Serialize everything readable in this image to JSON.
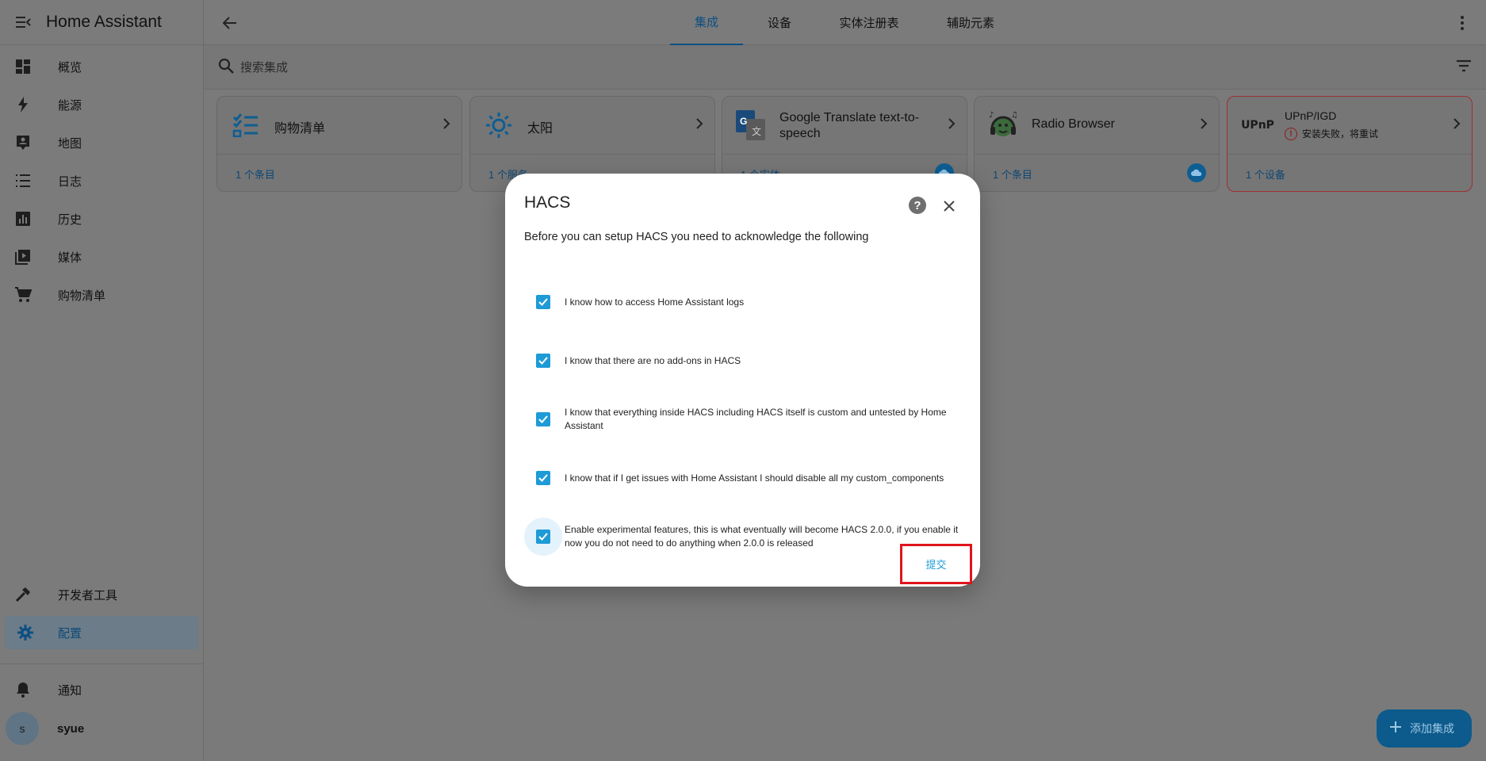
{
  "app": {
    "title": "Home Assistant"
  },
  "sidebar": {
    "items": [
      {
        "label": "概览",
        "icon": "dashboard-icon"
      },
      {
        "label": "能源",
        "icon": "lightning-icon"
      },
      {
        "label": "地图",
        "icon": "map-icon"
      },
      {
        "label": "日志",
        "icon": "list-icon"
      },
      {
        "label": "历史",
        "icon": "chart-icon"
      },
      {
        "label": "媒体",
        "icon": "media-icon"
      },
      {
        "label": "购物清单",
        "icon": "cart-icon"
      }
    ],
    "bottom_items": [
      {
        "label": "开发者工具",
        "icon": "hammer-icon"
      },
      {
        "label": "配置",
        "icon": "gear-icon",
        "active": true
      }
    ],
    "notifications_label": "通知",
    "user": {
      "initial": "s",
      "name": "syue"
    }
  },
  "topbar": {
    "tabs": [
      {
        "label": "集成",
        "active": true
      },
      {
        "label": "设备",
        "active": false
      },
      {
        "label": "实体注册表",
        "active": false
      },
      {
        "label": "辅助元素",
        "active": false
      }
    ]
  },
  "search": {
    "placeholder": "搜索集成"
  },
  "cards": [
    {
      "title": "购物清单",
      "link": "1 个条目"
    },
    {
      "title": "太阳",
      "link": "1 个服务"
    },
    {
      "title": "Google Translate text-to-speech",
      "link": "1 个实体",
      "cloud": true
    },
    {
      "title": "Radio Browser",
      "link": "1 个条目",
      "cloud": true
    },
    {
      "title": "UPnP/IGD",
      "logo_text": "UPnP",
      "subtitle": "安装失败，将重试",
      "link": "1 个设备",
      "error": true
    }
  ],
  "dialog": {
    "title": "HACS",
    "intro": "Before you can setup HACS you need to acknowledge the following",
    "checkboxes": [
      {
        "label": "I know how to access Home Assistant logs",
        "checked": true
      },
      {
        "label": "I know that there are no add-ons in HACS",
        "checked": true
      },
      {
        "label": "I know that everything inside HACS including HACS itself is custom and untested by Home Assistant",
        "checked": true
      },
      {
        "label": "I know that if I get issues with Home Assistant I should disable all my custom_components",
        "checked": true
      },
      {
        "label": "Enable experimental features, this is what eventually will become HACS 2.0.0, if you enable it now you do not need to do anything when 2.0.0 is released",
        "checked": true
      }
    ],
    "submit_label": "提交"
  },
  "fab": {
    "label": "添加集成"
  },
  "colors": {
    "accent": "#1e9bd7",
    "error": "#e0141b",
    "active_tab": "#0d4f82"
  }
}
